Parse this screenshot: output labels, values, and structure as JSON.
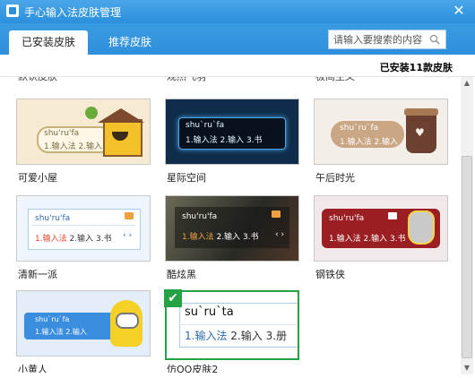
{
  "window": {
    "title": "手心输入法皮肤管理",
    "close": "✕"
  },
  "tabs": [
    {
      "label": "已安装皮肤",
      "active": true
    },
    {
      "label": "推荐皮肤",
      "active": false
    }
  ],
  "search": {
    "placeholder": "请输入要搜索的内容"
  },
  "installed_count": "已安装11款皮肤",
  "cut_labels": [
    "默认皮肤",
    "观然飞羽",
    "极简主义"
  ],
  "skins": [
    {
      "name": "可爱小屋",
      "pinyin": "shu'ru'fa",
      "cands": [
        "1.输入法",
        "2.输入"
      ]
    },
    {
      "name": "星际空间",
      "pinyin": "shu`ru`fa",
      "cands": [
        "1.输入法",
        "2.输入",
        "3.书"
      ]
    },
    {
      "name": "午后时光",
      "pinyin": "shu`ru`fa",
      "cands": [
        "1.输入法",
        "2.输入"
      ]
    },
    {
      "name": "清新一派",
      "pinyin": "shu'ru'fa",
      "cands": [
        "1.输入法",
        "2.输入",
        "3.书"
      ]
    },
    {
      "name": "酷炫黑",
      "pinyin": "shu'ru'fa",
      "cands": [
        "1.输入法",
        "2.输入",
        "3.书"
      ]
    },
    {
      "name": "钢铁侠",
      "pinyin": "shu'ru'fa",
      "cands": [
        "1.输入法",
        "2.输入",
        "3.书"
      ]
    },
    {
      "name": "小黄人",
      "pinyin": "shu`ru`fa",
      "cands": [
        "1.输入法",
        "2.输入"
      ]
    },
    {
      "name": "仿QQ皮肤2",
      "pinyin": "su`ru`ta",
      "cands": [
        "1.输入法",
        "2.输入",
        "3.册"
      ],
      "selected": true
    }
  ],
  "icons": {
    "search": "search-icon",
    "check": "checkmark-icon",
    "scroll_up": "▲",
    "scroll_down": "▼"
  },
  "colors": {
    "titlebar": "#2b8fdc",
    "selected_border": "#25a244",
    "accent_red": "#e0482f"
  }
}
